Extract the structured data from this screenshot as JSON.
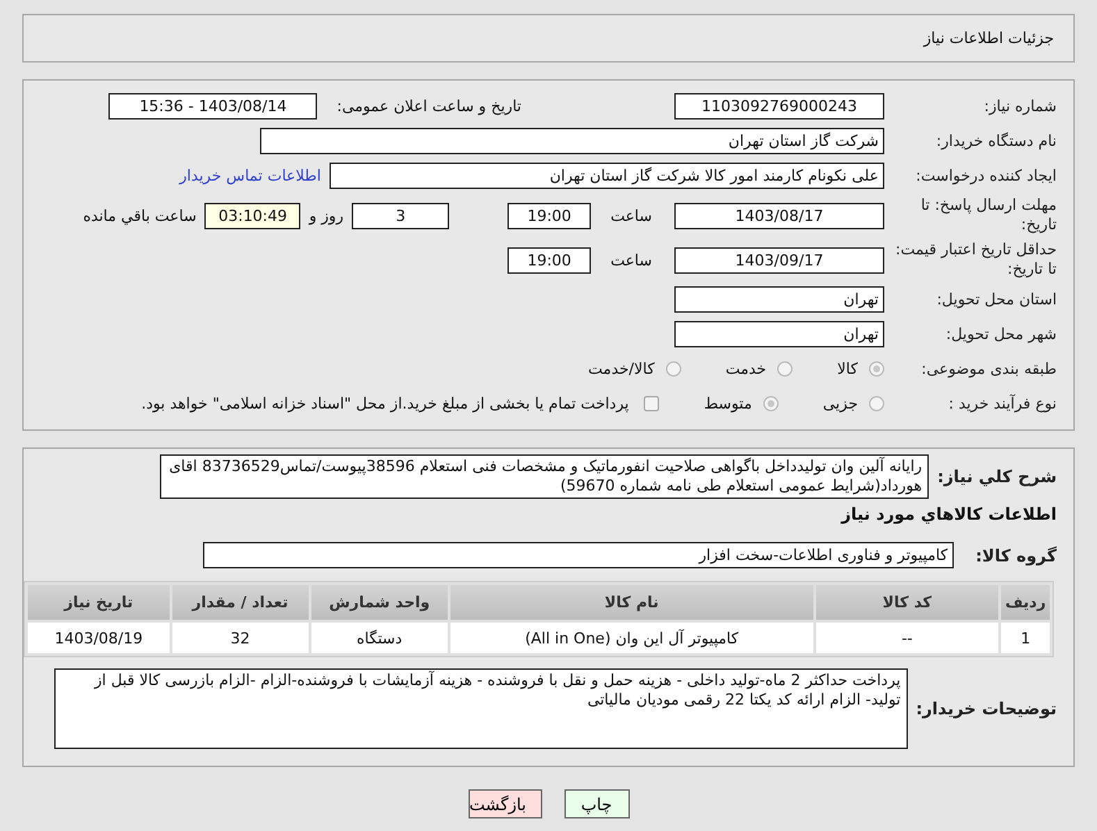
{
  "header": {
    "title": "جزئیات اطلاعات نیاز"
  },
  "need_number": {
    "label": "شماره نیاز:",
    "value": "1103092769000243"
  },
  "announce": {
    "label": "تاریخ و ساعت اعلان عمومی:",
    "value": "1403/08/14 - 15:36"
  },
  "buyer_org": {
    "label": "نام دستگاه خریدار:",
    "value": "شرکت گاز استان تهران"
  },
  "creator": {
    "label": "ایجاد کننده درخواست:",
    "value": "علی نکونام کارمند امور کالا شرکت گاز استان تهران",
    "link": "اطلاعات تماس خریدار"
  },
  "reply_deadline": {
    "label": "مهلت ارسال پاسخ: تا تاریخ:",
    "date": "1403/08/17",
    "time_label": "ساعت",
    "time": "19:00",
    "days": "3",
    "days_label": "روز و",
    "remaining": "03:10:49",
    "remaining_label": "ساعت باقي مانده"
  },
  "price_validity": {
    "label": "حداقل تاریخ اعتبار قیمت: تا تاریخ:",
    "date": "1403/09/17",
    "time_label": "ساعت",
    "time": "19:00"
  },
  "province": {
    "label": "استان محل تحویل:",
    "value": "تهران"
  },
  "city": {
    "label": "شهر محل تحویل:",
    "value": "تهران"
  },
  "category": {
    "label": "طبقه بندی موضوعی:",
    "options": [
      {
        "label": "کالا",
        "selected": true
      },
      {
        "label": "خدمت",
        "selected": false
      },
      {
        "label": "کالا/خدمت",
        "selected": false
      }
    ]
  },
  "purchase_type": {
    "label": "نوع فرآیند خرید :",
    "options": [
      {
        "label": "جزیی",
        "selected": false
      },
      {
        "label": "متوسط",
        "selected": true
      }
    ],
    "treasury": {
      "label": "پرداخت تمام یا بخشی از مبلغ خرید.از محل \"اسناد خزانه اسلامی\" خواهد بود.",
      "checked": false
    }
  },
  "description": {
    "label": "شرح کلي نياز:",
    "value": "رایانه آلین وان تولیدداخل باگواهی صلاحیت انفورماتیک و مشخصات فنی استعلام 38596پیوست/تماس83736529 اقای هورداد(شرایط عمومی استعلام طی نامه شماره 59670)"
  },
  "items_heading": "اطلاعات کالاهاي مورد نياز",
  "goods_group": {
    "label": "گروه کالا:",
    "value": "کامپیوتر و فناوری اطلاعات-سخت افزار"
  },
  "table": {
    "columns": [
      "ردیف",
      "کد کالا",
      "نام کالا",
      "واحد شمارش",
      "تعداد / مقدار",
      "تاریخ نیاز"
    ],
    "rows": [
      [
        "1",
        "--",
        "کامپیوتر آل این وان (All in One)",
        "دستگاه",
        "32",
        "1403/08/19"
      ]
    ]
  },
  "buyer_notes": {
    "label": "توضیحات خریدار:",
    "value": "پرداخت حداکثر 2 ماه-تولید داخلی - هزینه حمل و نقل با فروشنده - هزینه آزمایشات با فروشنده-الزام  -الزام بازرسی کالا قبل از تولید- الزام ارائه کد یکتا 22 رقمی مودیان مالیاتی"
  },
  "buttons": [
    {
      "label": "چاپ",
      "kind": "print"
    },
    {
      "label": "بازگشت",
      "kind": "back"
    }
  ]
}
